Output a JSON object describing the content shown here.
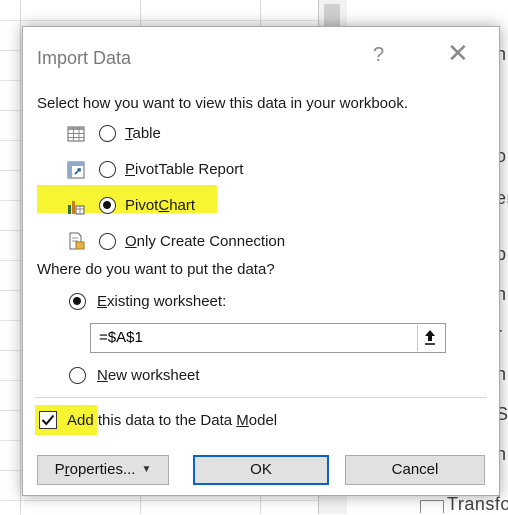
{
  "background": {
    "pane_fragments": [
      "n",
      "o",
      "er",
      "p",
      "h",
      "r",
      "n",
      "S",
      "h",
      "Transfo"
    ]
  },
  "dialog": {
    "title": "Import Data",
    "help_glyph": "?",
    "close_glyph": "✕",
    "view_prompt": "Select how you want to view this data in your workbook.",
    "view_options": [
      {
        "pre": "",
        "accel": "T",
        "post": "able",
        "icon": "table-icon",
        "selected": false
      },
      {
        "pre": "",
        "accel": "P",
        "post": "ivotTable Report",
        "icon": "pivottable-icon",
        "selected": false
      },
      {
        "pre": "Pivot",
        "accel": "C",
        "post": "hart",
        "icon": "pivotchart-icon",
        "selected": true
      },
      {
        "pre": "",
        "accel": "O",
        "post": "nly Create Connection",
        "icon": "connection-icon",
        "selected": false
      }
    ],
    "location_prompt": "Where do you want to put the data?",
    "existing": {
      "pre": "",
      "accel": "E",
      "post": "xisting worksheet:",
      "selected": true
    },
    "reference_value": "=$A$1",
    "new_sheet": {
      "pre": "",
      "accel": "N",
      "post": "ew worksheet",
      "selected": false
    },
    "data_model": {
      "pre": "Add this data to the Data ",
      "accel": "M",
      "post": "odel",
      "checked": true
    },
    "buttons": {
      "properties": {
        "pre": "P",
        "accel": "r",
        "post": "operties..."
      },
      "ok": "OK",
      "cancel": "Cancel"
    },
    "highlight_color": "#f7f532",
    "accent_color": "#0a64c8"
  }
}
